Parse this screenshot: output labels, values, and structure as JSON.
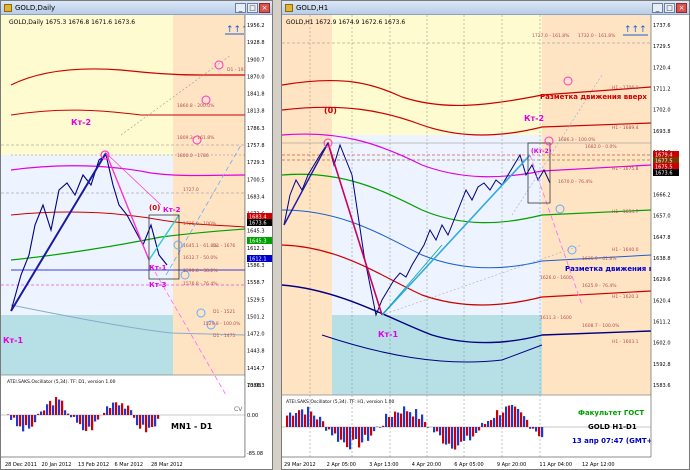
{
  "left": {
    "window_title": "GOLD,Daily",
    "ohlc": "GOLD,Daily  1675.3 1676.8 1671.6 1673.6",
    "annotations": {
      "kt2": "Кт-2",
      "kt2b": "Кт-2",
      "kt1": "Кт-1",
      "kt1b": "Кт-1",
      "kt3": "Кт-3",
      "zero": "(0)",
      "mn1": "MN1 - D1",
      "cv": "CV"
    },
    "level_labels": [
      "D1 - 1932.",
      "1860.8 - 200.0%",
      "1809.3 - 161.8%",
      "1800.0 - 1786",
      "1727.0",
      "1725.0 - 100%",
      "1645.1 - 61.8%",
      "D1 - 1676",
      "1612.7 - 50.0%",
      "1590.8 - 38.2%",
      "1576.8 - 76.4%",
      "D1 - 1521",
      "1529.8 - 100.0%",
      "D1 - 1475"
    ],
    "price_axis": [
      "1956.2",
      "1928.8",
      "1900.7",
      "1870.0",
      "1841.8",
      "1813.8",
      "1786.3",
      "1757.8",
      "1729.3",
      "1700.5",
      "1683.4",
      "1673.6",
      "1645.3",
      "1612.1",
      "1586.3",
      "1558.7",
      "1529.5",
      "1501.2",
      "1472.0",
      "1443.8",
      "1414.7",
      "1386.3"
    ],
    "price_badges": [
      {
        "text": "1683.4",
        "color": "#cc0000"
      },
      {
        "text": "1673.6",
        "color": "#000000"
      },
      {
        "text": "1645.3",
        "color": "#00a000"
      },
      {
        "text": "1612.1",
        "color": "#0000cc"
      }
    ],
    "osc_title": "ATEI.SAKS.Oscillator (5,34). TF: D1, version 1.00",
    "osc_axis": [
      "70.08",
      "0.00",
      "-85.08"
    ],
    "time_axis": [
      "28 Dec 2011",
      "20 Jan 2012",
      "13 Feb 2012",
      "6 Mar 2012",
      "28 Mar 2012"
    ]
  },
  "right": {
    "window_title": "GOLD,H1",
    "ohlc": "GOLD,H1  1672.9 1674.9 1672.6 1673.6",
    "annotations": {
      "zero": "(0)",
      "kt2": "Кт-2",
      "kt1": "Кт-1",
      "kt2box": "(Кт-2)",
      "move_up": "Разметка движения вверх",
      "move_down": "Разметка движения вниз",
      "faculty": "Факультет ГОСТ",
      "instrument": "GOLD   H1-D1",
      "datetime": "13 апр 07:47  (GMT+2)"
    },
    "level_labels": [
      "1727.0 - 161.8%",
      "1732.0 - 161.8%",
      "H1 - 1706.1",
      "H1 - 1689.4",
      "1686.3 - 100.0%",
      "1682.0 - 0.0%",
      "H1 - 1675.8",
      "1670.0 - 76.4%",
      "H1 - 1654.7",
      "H1 - 1640.0",
      "1635.9 - 61.8%",
      "1626.0 - 1600",
      "1625.9 - 76.4%",
      "H1 - 1620.3",
      "1611.3 - 1600",
      "1608.7 - 100.0%",
      "H1 - 1603.1"
    ],
    "price_axis": [
      "1737.6",
      "1729.5",
      "1720.4",
      "1711.2",
      "1702.0",
      "1693.8",
      "1684.6",
      "1675.4",
      "1666.2",
      "1657.0",
      "1647.8",
      "1638.8",
      "1629.6",
      "1620.4",
      "1611.2",
      "1602.0",
      "1592.8",
      "1583.6"
    ],
    "price_badges": [
      {
        "text": "1679.4",
        "color": "#cc0000"
      },
      {
        "text": "1677.5",
        "color": "#7a3b00"
      },
      {
        "text": "1675.5",
        "color": "#cc0000"
      },
      {
        "text": "1673.6",
        "color": "#000000"
      }
    ],
    "osc_title": "ATEI.SAKS.Oscillator (5,34). TF: H1, version 1.00",
    "time_axis": [
      "29 Mar 2012",
      "2 Apr 05:00",
      "3 Apr 13:00",
      "4 Apr 20:00",
      "6 Apr 05:00",
      "9 Apr 20:00",
      "11 Apr 04:00",
      "12 Apr 12:00"
    ]
  },
  "colors": {
    "zone_yellow": "#fffbd0",
    "zone_peach": "#ffe4c4",
    "zone_blue": "#eef4ff",
    "zone_cyan": "#b7e0e6",
    "magenta": "#e000e0",
    "red": "#cc0000",
    "green": "#00a000",
    "navy": "#000080"
  }
}
